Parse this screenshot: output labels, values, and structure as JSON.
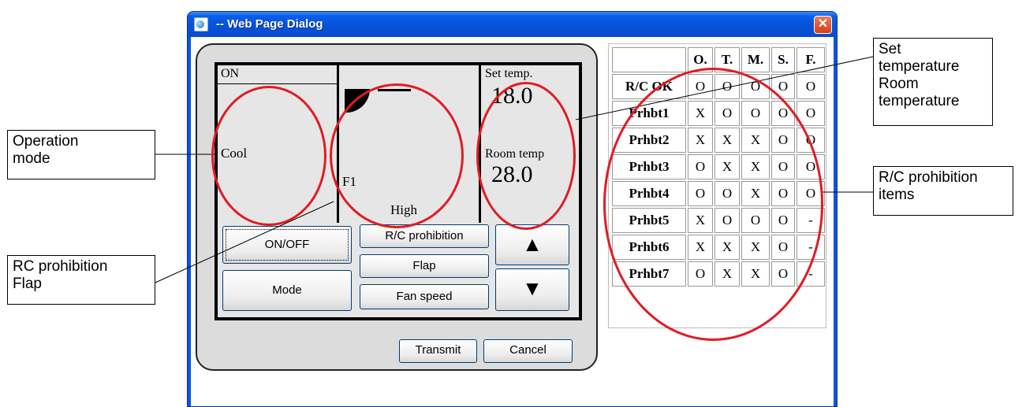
{
  "window": {
    "title": "-- Web Page Dialog",
    "close_glyph": "✕"
  },
  "lcd": {
    "on_status": "ON",
    "operation_mode": "Cool",
    "flap": "F1",
    "fan_speed": "High",
    "set_temp_label": "Set temp.",
    "set_temp_value": "18.0",
    "room_temp_label": "Room temp",
    "room_temp_value": "28.0"
  },
  "buttons": {
    "on_off": "ON/OFF",
    "mode": "Mode",
    "rc_prohibition": "R/C prohibition",
    "flap": "Flap",
    "fan_speed": "Fan speed",
    "up_arrow": "▲",
    "down_arrow": "▼",
    "transmit": "Transmit",
    "cancel": "Cancel"
  },
  "prohibition_table": {
    "columns": [
      "",
      "O.",
      "T.",
      "M.",
      "S.",
      "F."
    ],
    "rows": [
      {
        "label": "R/C OK",
        "values": [
          "O",
          "O",
          "O",
          "O",
          "O"
        ]
      },
      {
        "label": "Prhbt1",
        "values": [
          "X",
          "O",
          "O",
          "O",
          "O"
        ]
      },
      {
        "label": "Prhbt2",
        "values": [
          "X",
          "X",
          "X",
          "O",
          "O"
        ]
      },
      {
        "label": "Prhbt3",
        "values": [
          "O",
          "X",
          "X",
          "O",
          "O"
        ]
      },
      {
        "label": "Prhbt4",
        "values": [
          "O",
          "O",
          "X",
          "O",
          "O"
        ]
      },
      {
        "label": "Prhbt5",
        "values": [
          "X",
          "O",
          "O",
          "O",
          "-"
        ]
      },
      {
        "label": "Prhbt6",
        "values": [
          "X",
          "X",
          "X",
          "O",
          "-"
        ]
      },
      {
        "label": "Prhbt7",
        "values": [
          "O",
          "X",
          "X",
          "O",
          "-"
        ]
      }
    ]
  },
  "annotations": {
    "operation_mode": "Operation\nmode",
    "rc_prohibition_flap": "RC prohibition\nFlap",
    "set_room_temp": "Set\ntemperature\nRoom\ntemperature",
    "rc_prohibition_items": "R/C prohibition\nitems"
  },
  "colors": {
    "annotation_red": "#e01b23",
    "titlebar_blue": "#0a54e0",
    "panel_gray": "#dcdcdc"
  }
}
